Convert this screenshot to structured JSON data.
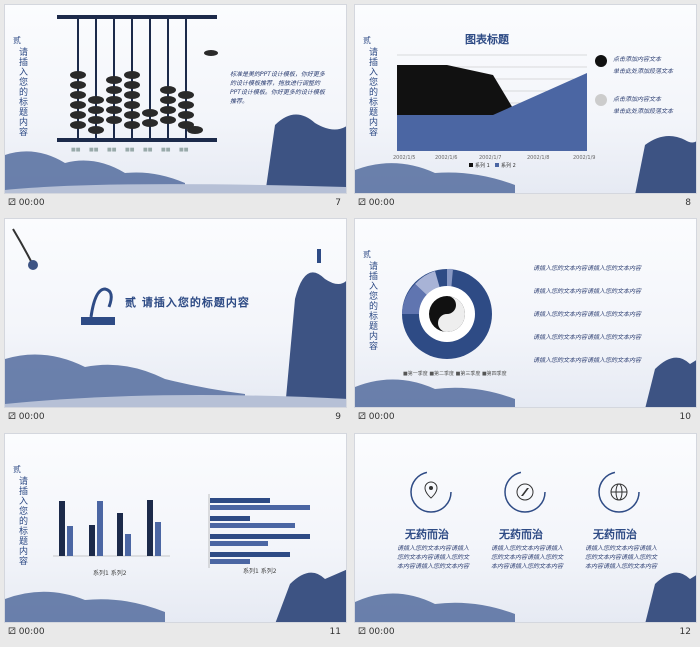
{
  "slides": [
    {
      "num": "7",
      "time": "00:00",
      "vertical_title": "请插入您的标题内容",
      "num_label": "贰",
      "body": "标准是美的PPT设计模板，你好更多的设计模板推荐，拖放进行调整的PPT设计模板。你好更多的设计模板推荐。"
    },
    {
      "num": "8",
      "time": "00:00",
      "vertical_title": "请插入您的标题内容",
      "num_label": "贰",
      "chart_title": "图表标题",
      "dates": [
        "2002/1/5",
        "2002/1/6",
        "2002/1/7",
        "2002/1/8",
        "2002/1/9"
      ],
      "legend": [
        "系列 1",
        "系列 2"
      ],
      "items": [
        "点击添加内容文本",
        "单击此处添加段落文本",
        "点击添加内容文本",
        "单击此处添加段落文本"
      ]
    },
    {
      "num": "9",
      "time": "00:00",
      "title": "贰 请插入您的标题内容"
    },
    {
      "num": "10",
      "time": "00:00",
      "vertical_title": "请插入您的标题内容",
      "num_label": "贰",
      "rows": [
        "请插入您的文本内容请插入您的文本内容",
        "请插入您的文本内容请插入您的文本内容",
        "请插入您的文本内容请插入您的文本内容",
        "请插入您的文本内容请插入您的文本内容",
        "请插入您的文本内容请插入您的文本内容"
      ]
    },
    {
      "num": "11",
      "time": "00:00",
      "vertical_title": "请插入您的标题内容",
      "num_label": "贰",
      "legend1": "系列1 系列2",
      "legend2": "系列1 系列2"
    },
    {
      "num": "12",
      "time": "00:00",
      "cards": [
        {
          "title": "无药而治",
          "body": "请插入您的文本内容请插入您的文本内容请插入您的文本内容请插入您的文本内容"
        },
        {
          "title": "无药而治",
          "body": "请插入您的文本内容请插入您的文本内容请插入您的文本内容请插入您的文本内容"
        },
        {
          "title": "无药而治",
          "body": "请插入您的文本内容请插入您的文本内容请插入您的文本内容请插入您的文本内容"
        }
      ]
    }
  ],
  "colors": {
    "navy": "#2e4b85",
    "ink": "#1c2a4a"
  }
}
